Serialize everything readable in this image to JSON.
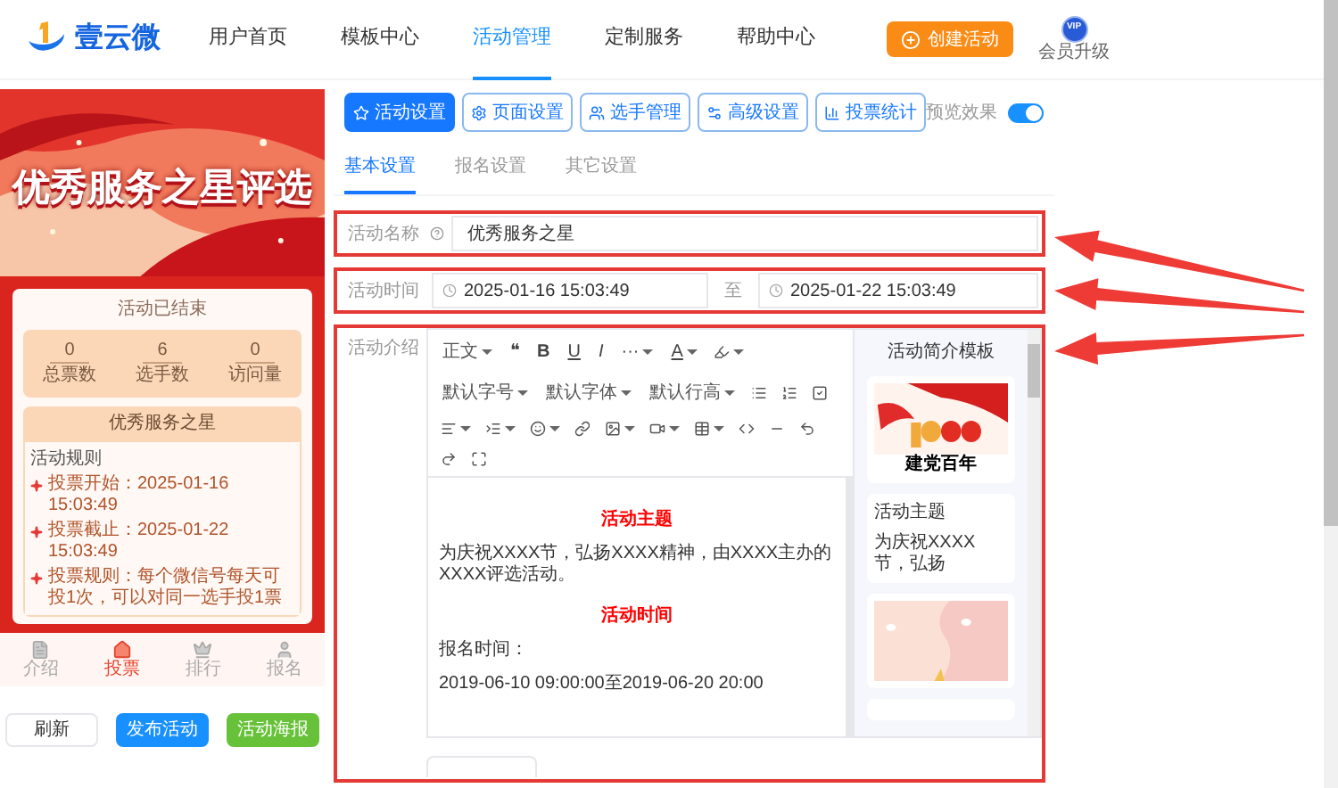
{
  "header": {
    "logo": "壹云微",
    "nav": [
      {
        "label": "用户首页",
        "selected": false
      },
      {
        "label": "模板中心",
        "selected": false
      },
      {
        "label": "活动管理",
        "selected": true
      },
      {
        "label": "定制服务",
        "selected": false
      },
      {
        "label": "帮助中心",
        "selected": false
      }
    ],
    "create_button": "创建活动",
    "vip_badge": "VIP",
    "vip_caption": "会员升级"
  },
  "preview": {
    "title": "优秀服务之星评选",
    "status": "活动已结束",
    "stats": [
      {
        "value": "0",
        "label": "总票数"
      },
      {
        "value": "6",
        "label": "选手数"
      },
      {
        "value": "0",
        "label": "访问量"
      }
    ],
    "name": "优秀服务之星",
    "rules_title": "活动规则",
    "rules": [
      "投票开始：2025-01-16 15:03:49",
      "投票截止：2025-01-22 15:03:49",
      "投票规则：每个微信号每天可投1次，可以对同一选手投1票"
    ],
    "nav": [
      {
        "label": "介绍",
        "selected": false
      },
      {
        "label": "投票",
        "selected": true
      },
      {
        "label": "排行",
        "selected": false
      },
      {
        "label": "报名",
        "selected": false
      }
    ],
    "buttons": [
      {
        "label": "刷新",
        "kind": "default"
      },
      {
        "label": "发布活动",
        "kind": "primary"
      },
      {
        "label": "活动海报",
        "kind": "success"
      }
    ]
  },
  "toolbar": {
    "buttons": [
      {
        "label": "活动设置",
        "selected": true
      },
      {
        "label": "页面设置",
        "selected": false
      },
      {
        "label": "选手管理",
        "selected": false
      },
      {
        "label": "高级设置",
        "selected": false
      },
      {
        "label": "投票统计",
        "selected": false
      }
    ],
    "preview_label": "预览效果",
    "preview_on": true
  },
  "subtabs": [
    {
      "label": "基本设置",
      "selected": true
    },
    {
      "label": "报名设置",
      "selected": false
    },
    {
      "label": "其它设置",
      "selected": false
    }
  ],
  "form": {
    "name_label": "活动名称",
    "name_value": "优秀服务之星",
    "time_label": "活动时间",
    "start": "2025-01-16 15:03:49",
    "separator": "至",
    "end": "2025-01-22 15:03:49",
    "intro_label": "活动介绍"
  },
  "editor": {
    "selects": [
      "正文",
      "默认字号",
      "默认字体",
      "默认行高"
    ],
    "glyphs": [
      "❝",
      "B",
      "U",
      "I",
      "···",
      "A"
    ],
    "content": [
      {
        "kind": "heading",
        "text": "活动主题"
      },
      {
        "kind": "paragraph",
        "text": "为庆祝XXXX节，弘扬XXXX精神，由XXXX主办的XXXX评选活动。"
      },
      {
        "kind": "heading",
        "text": "活动时间"
      },
      {
        "kind": "paragraph",
        "text": "报名时间："
      },
      {
        "kind": "paragraph",
        "text": "2019-06-10 09:00:00至2019-06-20 20:00"
      }
    ]
  },
  "templates": {
    "title": "活动简介模板",
    "items": [
      {
        "kind": "picture",
        "caption": "建党百年"
      },
      {
        "kind": "text",
        "heading": "活动主题",
        "text": "为庆祝XXXX节，弘扬"
      },
      {
        "kind": "picture"
      },
      {
        "kind": "blank"
      }
    ]
  }
}
